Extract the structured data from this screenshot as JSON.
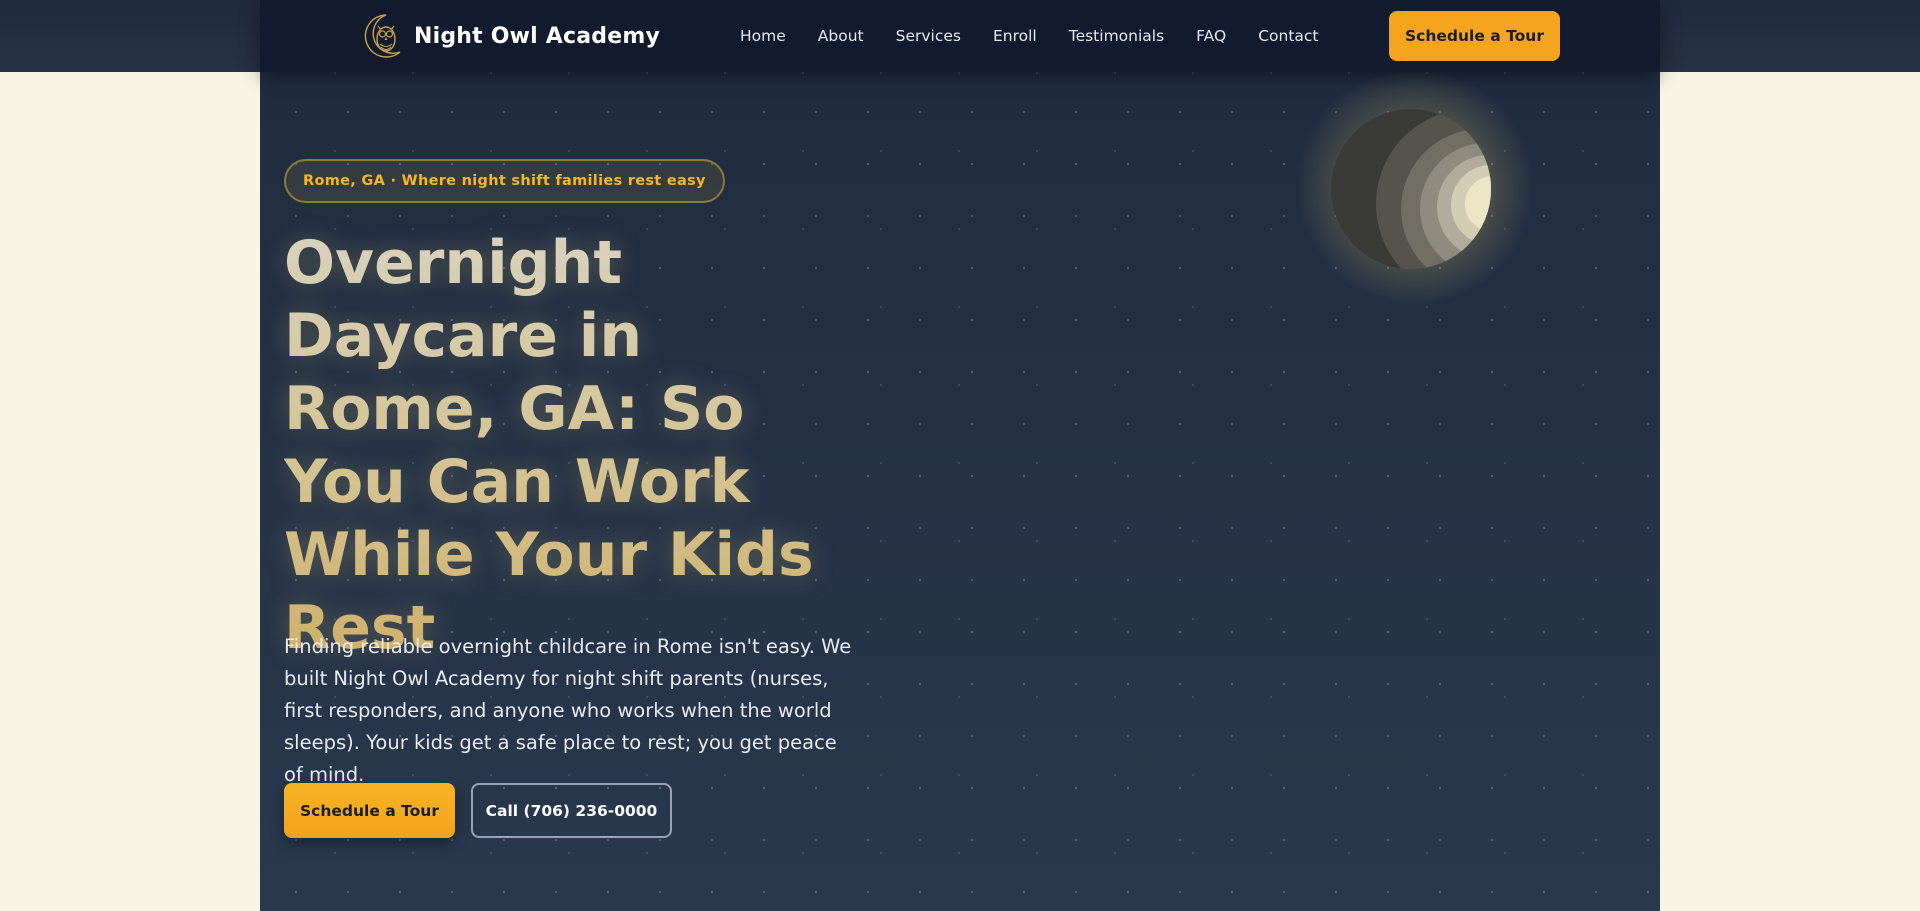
{
  "nav": {
    "brand_name": "Night Owl Academy",
    "logo_icon": "owl-moon-icon",
    "items": [
      {
        "label": "Home"
      },
      {
        "label": "About"
      },
      {
        "label": "Services"
      },
      {
        "label": "Enroll"
      },
      {
        "label": "Testimonials"
      },
      {
        "label": "FAQ"
      },
      {
        "label": "Contact"
      }
    ],
    "cta_label": "Schedule a Tour"
  },
  "hero": {
    "badge": "Rome, GA · Where night shift families rest easy",
    "headline": "Overnight Daycare in Rome, GA: So You Can Work While Your Kids Rest",
    "description": "Finding reliable overnight childcare in Rome isn't easy. We built Night Owl Academy for night shift parents (nurses, first responders, and anyone who works when the world sleeps). Your kids get a safe place to rest; you get peace of mind.",
    "primary_button": "Schedule a Tour",
    "secondary_button": "Call (706) 236-0000",
    "moon_icon": "moon-icon"
  },
  "colors": {
    "accent": "#f5a41f",
    "nav_bg": "#121a2d",
    "hero_bg": "#253246",
    "page_bg": "#f8f5e4"
  }
}
